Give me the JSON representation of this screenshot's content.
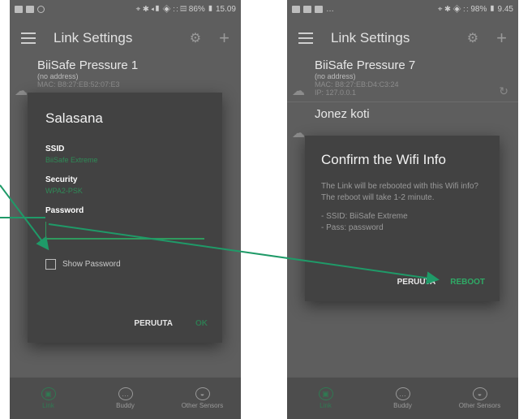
{
  "left_phone": {
    "status": {
      "right": "⌖ ✱ ◂▮ ◈ ∷ ▤ 86% ▮ 15.09"
    },
    "appbar": {
      "title": "Link Settings"
    },
    "devices": [
      {
        "name": "BiiSafe Pressure 1",
        "sub": "(no address)",
        "mac": "MAC: B8:27:EB:52:07:E3"
      }
    ],
    "dialog": {
      "title": "Salasana",
      "ssid_label": "SSID",
      "ssid_value": "BiiSafe Extreme",
      "security_label": "Security",
      "security_value": "WPA2-PSK",
      "password_label": "Password",
      "password_value": "",
      "show_password_label": "Show Password",
      "cancel_label": "PERUUTA",
      "ok_label": "OK"
    },
    "nav": [
      {
        "label": "Link",
        "icon": "link-icon"
      },
      {
        "label": "Buddy",
        "icon": "buddy-icon"
      },
      {
        "label": "Other Sensors",
        "icon": "sensor-icon"
      }
    ]
  },
  "right_phone": {
    "status": {
      "right": "⌖ ✱ ◈ ∷ 98% ▮ 9.45"
    },
    "appbar": {
      "title": "Link Settings"
    },
    "devices": [
      {
        "name": "BiiSafe Pressure 7",
        "sub": "(no address)",
        "mac": "MAC: B8:27:EB:D4:C3:24",
        "ip": "IP: 127.0.0.1"
      },
      {
        "name": "Jonez koti",
        "sub": ""
      }
    ],
    "dialog": {
      "title": "Confirm the Wifi Info",
      "body": "The Link will be rebooted with this Wifi info? The reboot will take 1-2 minute.",
      "ssid_line": "- SSID: BiiSafe Extreme",
      "pass_line": "- Pass: password",
      "cancel_label": "PERUUTA",
      "reboot_label": "REBOOT"
    },
    "nav": [
      {
        "label": "Link",
        "icon": "link-icon"
      },
      {
        "label": "Buddy",
        "icon": "buddy-icon"
      },
      {
        "label": "Other Sensors",
        "icon": "sensor-icon"
      }
    ]
  },
  "colors": {
    "accent": "#2f9a5e",
    "arrow": "#1f9a68",
    "dialog_bg": "#424242",
    "screen_bg": "#5e5e5e"
  }
}
